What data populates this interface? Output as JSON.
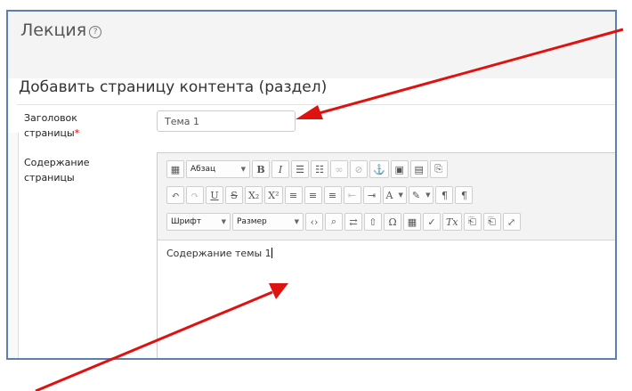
{
  "page": {
    "lesson_title": "Лекция",
    "help_glyph": "?",
    "section_title": "Добавить страницу контента (раздел)"
  },
  "form": {
    "title_label": "Заголовок страницы",
    "required_mark": "*",
    "title_value": "Тема 1",
    "content_label": "Содержание страницы",
    "content_value": "Содержание темы 1"
  },
  "toolbar": {
    "row1": {
      "format_select": "Абзац",
      "bold": "B",
      "italic": "I"
    },
    "row2": {
      "underline": "U",
      "strike": "S",
      "sub": "X₂",
      "sup": "X²",
      "font_color": "A",
      "pilcrow_ltr": "¶",
      "pilcrow_rtl": "¶"
    },
    "row3": {
      "font_select": "Шрифт",
      "size_select": "Размер",
      "sub_fx": "Tx"
    }
  },
  "colors": {
    "frame_border": "#5b7fb0",
    "arrow": "#e0120f",
    "required": "#cc0000"
  }
}
